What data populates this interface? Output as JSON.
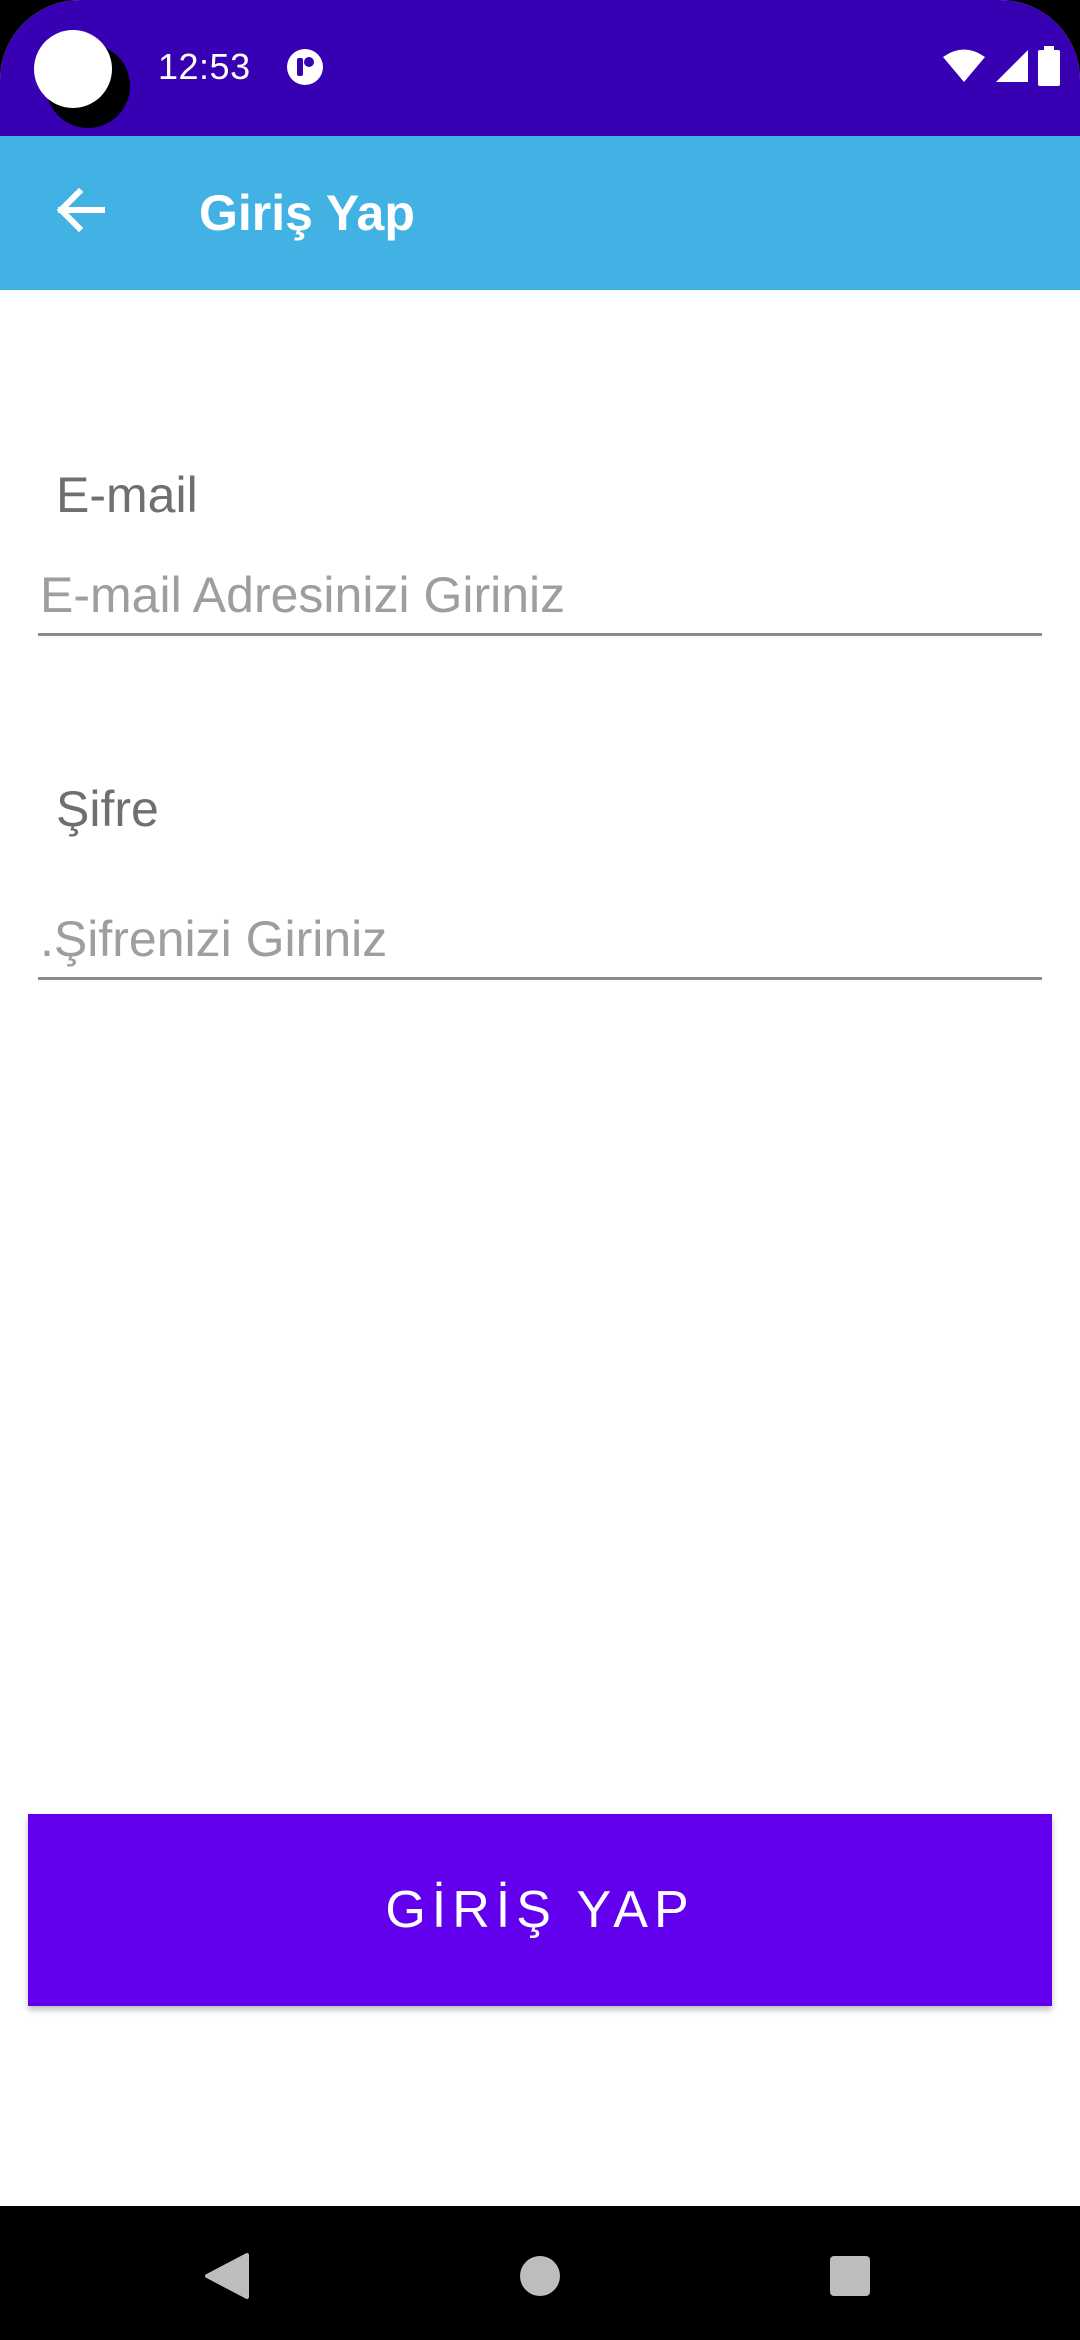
{
  "status_bar": {
    "time": "12:53",
    "background": "#3700b3",
    "icons": [
      "app-notification-icon",
      "wifi-icon",
      "signal-icon",
      "battery-icon"
    ]
  },
  "app_bar": {
    "title": "Giriş Yap",
    "background": "#42b1e4",
    "back_icon": "arrow-left-icon"
  },
  "form": {
    "email": {
      "label": "E-mail",
      "placeholder": "E-mail Adresinizi Giriniz",
      "value": ""
    },
    "password": {
      "label": "Şifre",
      "placeholder": ".Şifrenizi Giriniz",
      "value": ""
    }
  },
  "login_button": {
    "label": "GİRİŞ YAP",
    "color": "#6200ee"
  },
  "nav_bar": {
    "icons": [
      "back-triangle-icon",
      "home-circle-icon",
      "recents-square-icon"
    ]
  }
}
